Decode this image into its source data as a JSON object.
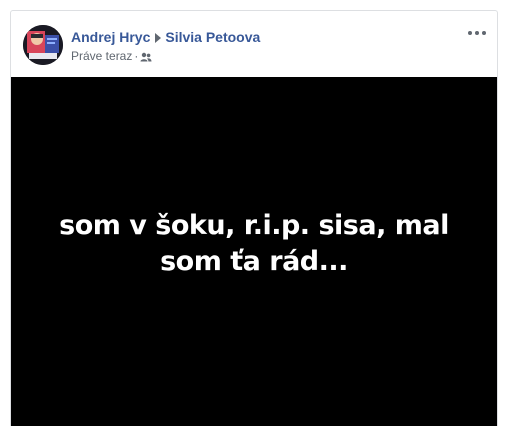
{
  "post": {
    "author": "Andrej Hryc",
    "recipient": "Silvia Petoova",
    "timestamp": "Práve teraz",
    "separator": "·",
    "privacy_icon": "friends-icon",
    "menu_icon": "more-options-icon",
    "status_text": "som v šoku, r.i.p. sisa, mal som ťa rád...",
    "status_background": "#000000",
    "status_text_color": "#ffffff",
    "name_color": "#385898"
  }
}
